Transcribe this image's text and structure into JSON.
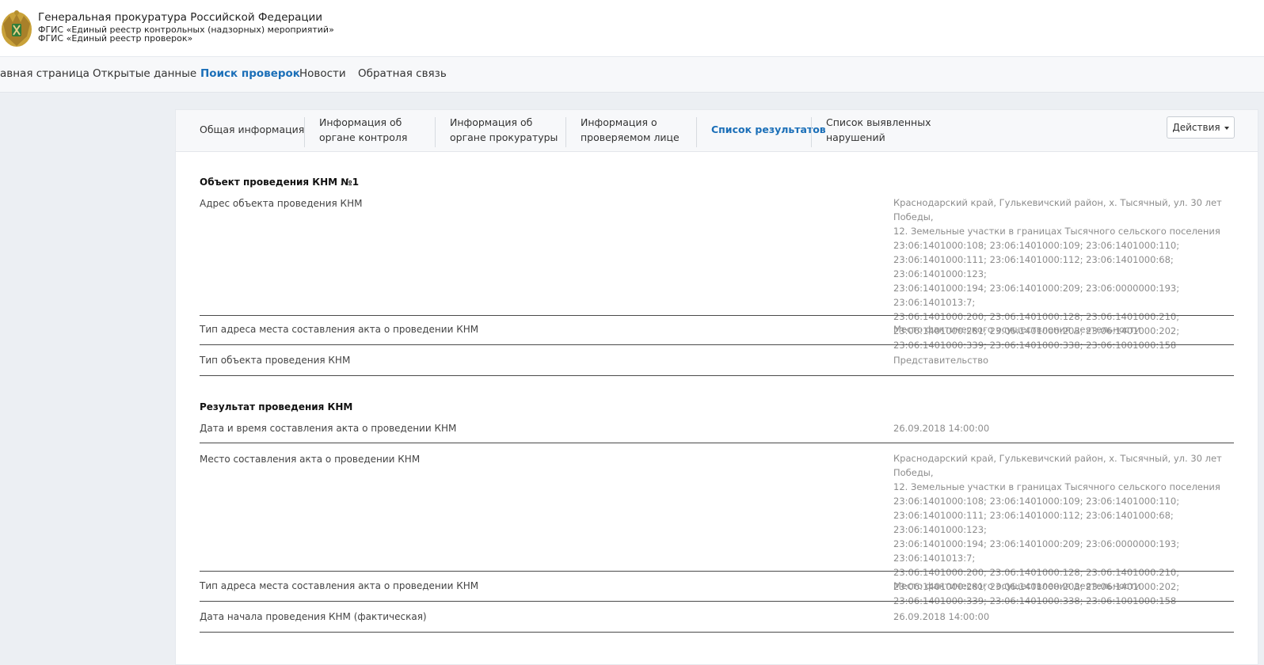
{
  "header": {
    "org_name": "Генеральная прокуратура Российской Федерации",
    "system_name_1": "ФГИС «Единый реестр контрольных (надзорных) мероприятий»",
    "system_name_2": "ФГИС «Единый реестр проверок»",
    "emblem_icon": "double-headed-eagle-emblem-icon"
  },
  "nav": {
    "items": [
      {
        "label": "авная страница"
      },
      {
        "label": "Открытые данные"
      },
      {
        "label": "Поиск проверок"
      },
      {
        "label": "Новости"
      },
      {
        "label": "Обратная связь"
      }
    ],
    "active_index": 2
  },
  "tabs": {
    "items": [
      {
        "line1": "Общая информация",
        "line2": ""
      },
      {
        "line1": "Информация об",
        "line2": "органе контроля"
      },
      {
        "line1": "Информация об",
        "line2": "органе прокуратуры"
      },
      {
        "line1": "Информация о",
        "line2": "проверяемом лице"
      },
      {
        "line1": "Список результатов",
        "line2": ""
      },
      {
        "line1": "Список выявленных",
        "line2": "нарушений"
      }
    ],
    "active_index": 4,
    "actions_label": "Действия"
  },
  "object_section": {
    "title": "Объект проведения КНМ №1",
    "rows": [
      {
        "label": "Адрес объекта проведения КНМ",
        "value_lines": [
          "Краснодарский край, Гулькевичский район, х. Тысячный, ул. 30 лет Победы,",
          "12. Земельные участки в границах Тысячного сельского поселения",
          "23:06:1401000:108; 23:06:1401000:109; 23:06:1401000:110;",
          "23:06:1401000:111; 23:06:1401000:112; 23:06:1401000:68; 23:06:1401000:123;",
          "23:06:1401000:194; 23:06:1401000:209; 23:06:0000000:193; 23:06:1401013:7;",
          "23:06:1401000:200; 23:06:1401000:128; 23:06:1401000:210;",
          "23:06:1401000:281; 23:06:1401000:203; 23:06:1401000:202;",
          "23:06:1401000:339; 23:06:1401000:338; 23:06:1001000:158"
        ]
      },
      {
        "label": "Тип адреса места составления акта о проведении КНМ",
        "value": "Место фактического осуществления деятельности"
      },
      {
        "label": "Тип объекта проведения КНМ",
        "value": "Представительство"
      }
    ]
  },
  "result_section": {
    "title": "Результат проведения КНМ",
    "rows": [
      {
        "label": "Дата и время составления акта о проведении КНМ",
        "value": "26.09.2018 14:00:00"
      },
      {
        "label": "Место составления акта о проведении КНМ",
        "value_lines": [
          "Краснодарский край, Гулькевичский район, х. Тысячный, ул. 30 лет Победы,",
          "12. Земельные участки в границах Тысячного сельского поселения",
          "23:06:1401000:108; 23:06:1401000:109; 23:06:1401000:110;",
          "23:06:1401000:111; 23:06:1401000:112; 23:06:1401000:68; 23:06:1401000:123;",
          "23:06:1401000:194; 23:06:1401000:209; 23:06:0000000:193; 23:06:1401013:7;",
          "23:06:1401000:200; 23:06:1401000:128; 23:06:1401000:210;",
          "23:06:1401000:281; 23:06:1401000:203; 23:06:1401000:202;",
          "23:06:1401000:339; 23:06:1401000:338; 23:06:1001000:158"
        ]
      },
      {
        "label": "Тип адреса места составления акта о проведении КНМ",
        "value": "Место фактического осуществления деятельности"
      },
      {
        "label": "Дата начала проведения КНМ (фактическая)",
        "value": "26.09.2018 14:00:00"
      }
    ]
  }
}
